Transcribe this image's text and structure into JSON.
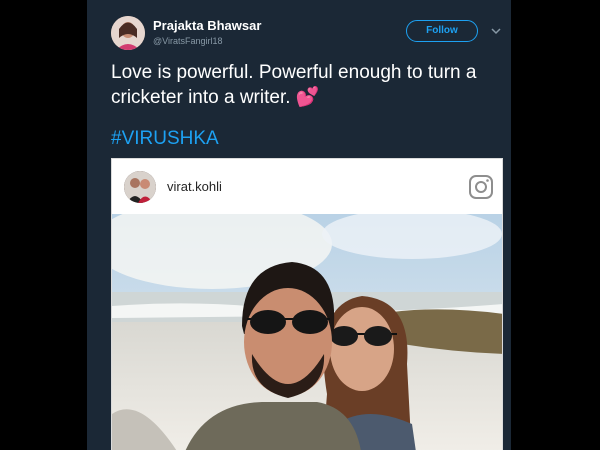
{
  "tweet": {
    "author": {
      "name": "Prajakta Bhawsar",
      "handle": "@ViratsFangirl18"
    },
    "follow_label": "Follow",
    "text": "Love is powerful. Powerful enough to turn a cricketer into a writer.",
    "emoji": "💕",
    "hashtag": "#VIRUSHKA"
  },
  "instagram_embed": {
    "username": "virat.kohli",
    "icon": "instagram-icon"
  },
  "colors": {
    "card_bg": "#1b2836",
    "accent": "#1da1f2",
    "muted": "#8899a6",
    "emoji_pink": "#e8507a"
  }
}
